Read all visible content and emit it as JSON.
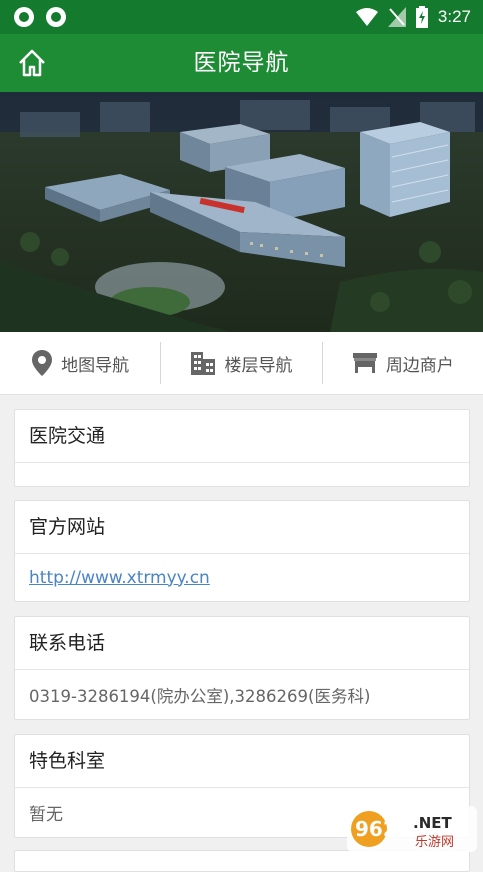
{
  "status": {
    "time": "3:27"
  },
  "header": {
    "title": "医院导航"
  },
  "nav": [
    {
      "label": "地图导航",
      "icon": "location-pin-icon"
    },
    {
      "label": "楼层导航",
      "icon": "building-icon"
    },
    {
      "label": "周边商户",
      "icon": "store-icon"
    }
  ],
  "sections": [
    {
      "title": "医院交通",
      "value": ""
    },
    {
      "title": "官方网站",
      "value": "http://www.xtrmyy.cn"
    },
    {
      "title": "联系电话",
      "value": "0319-3286194(院办公室),3286269(医务科)"
    },
    {
      "title": "特色科室",
      "value": "暂无"
    }
  ],
  "watermark": {
    "text1": "962",
    "text2": ".NET",
    "text3": "乐游网"
  },
  "colors": {
    "primary": "#1e8b35",
    "statusbar": "#147a2d",
    "link": "#4a84c4"
  }
}
